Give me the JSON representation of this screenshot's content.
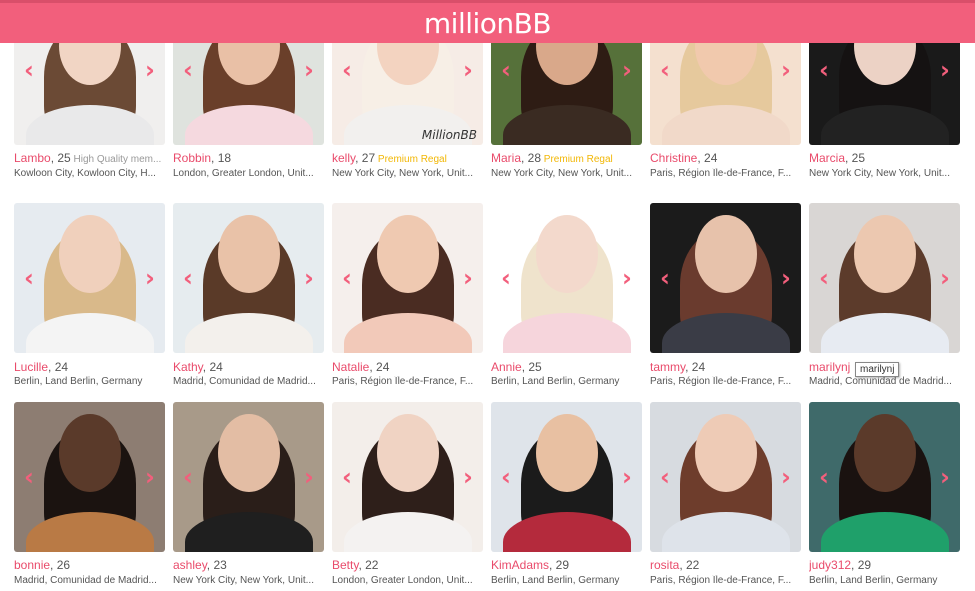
{
  "header": {
    "logo_text": "millionBB",
    "brand_color": "#f25f7c"
  },
  "tooltip": {
    "text": "marilynj"
  },
  "profiles": [
    {
      "name": "Lambo",
      "age": ", 25",
      "tag": " High Quality mem...",
      "tag_style": "grey",
      "location": "Kowloon City, Kowloon City, H...",
      "skin": "#f1d5c4",
      "hair": "#6b4a35",
      "cloth": "#e9e9ea",
      "bg": "#f0efee"
    },
    {
      "name": "Robbin",
      "age": ", 18",
      "tag": "",
      "tag_style": "",
      "location": "London, Greater London, Unit...",
      "skin": "#e9c0a6",
      "hair": "#6a3f2a",
      "cloth": "#f5d9df",
      "bg": "#dfe3de"
    },
    {
      "name": "kelly",
      "age": ", 27",
      "tag": " Premium Regal",
      "tag_style": "gold",
      "location": "New York City, New York, Unit...",
      "skin": "#f3d3c0",
      "hair": "#f7efe6",
      "cloth": "#f2f0ee",
      "bg": "#f6ece6",
      "watermark": "MillionBB"
    },
    {
      "name": "Maria",
      "age": ", 28",
      "tag": " Premium Regal",
      "tag_style": "gold",
      "location": "New York City, New York, Unit...",
      "skin": "#d9a88a",
      "hair": "#2e1c14",
      "cloth": "#3a2b22",
      "bg": "#56713a"
    },
    {
      "name": "Christine",
      "age": ", 24",
      "tag": "",
      "tag_style": "",
      "location": "Paris, Région Île-de-France, F...",
      "skin": "#f1c9ad",
      "hair": "#e6c99d",
      "cloth": "#f1d9c9",
      "bg": "#f4e0cf"
    },
    {
      "name": "Marcia",
      "age": ", 25",
      "tag": "",
      "tag_style": "",
      "location": "New York City, New York, Unit...",
      "skin": "#ecd2c5",
      "hair": "#151212",
      "cloth": "#222222",
      "bg": "#1a1a1a"
    },
    {
      "name": "Lucille",
      "age": ", 24",
      "tag": "",
      "tag_style": "",
      "location": "Berlin, Land Berlin, Germany",
      "skin": "#f0d0bc",
      "hair": "#d9b98a",
      "cloth": "#f4f4f4",
      "bg": "#e6ebf0"
    },
    {
      "name": "Kathy",
      "age": ", 24",
      "tag": "",
      "tag_style": "",
      "location": "Madrid, Comunidad de Madrid...",
      "skin": "#e9c2a8",
      "hair": "#5a3a28",
      "cloth": "#f3f0ec",
      "bg": "#e6ecef"
    },
    {
      "name": "Natalie",
      "age": ", 24",
      "tag": "",
      "tag_style": "",
      "location": "Paris, Région Île-de-France, F...",
      "skin": "#efc9b1",
      "hair": "#4a2c22",
      "cloth": "#f2c9b9",
      "bg": "#f5efec"
    },
    {
      "name": "Annie",
      "age": ", 25",
      "tag": "",
      "tag_style": "",
      "location": "Berlin, Land Berlin, Germany",
      "skin": "#f3d9cc",
      "hair": "#efe3cc",
      "cloth": "#f6d5dc",
      "bg": "#ffffff"
    },
    {
      "name": "tammy",
      "age": ", 24",
      "tag": "",
      "tag_style": "",
      "location": "Paris, Région Île-de-France, F...",
      "skin": "#e7c2ab",
      "hair": "#6a3b2e",
      "cloth": "#3a3c46",
      "bg": "#1b1b1b"
    },
    {
      "name": "marilynj",
      "age": "",
      "tag": "",
      "tag_style": "",
      "location": "Madrid, Comunidad de Madrid...",
      "skin": "#ecc8b0",
      "hair": "#5c3b2b",
      "cloth": "#e7ebf2",
      "bg": "#d9d6d4"
    },
    {
      "name": "bonnie",
      "age": ", 26",
      "tag": "",
      "tag_style": "",
      "location": "Madrid, Comunidad de Madrid...",
      "skin": "#5a3a2a",
      "hair": "#1b1310",
      "cloth": "#b97a45",
      "bg": "#8d7d72"
    },
    {
      "name": "ashley",
      "age": ", 23",
      "tag": "",
      "tag_style": "",
      "location": "New York City, New York, Unit...",
      "skin": "#e3bda4",
      "hair": "#2a1e19",
      "cloth": "#1f1f1f",
      "bg": "#a89a89"
    },
    {
      "name": "Betty",
      "age": ", 22",
      "tag": "",
      "tag_style": "",
      "location": "London, Greater London, Unit...",
      "skin": "#f0d3c3",
      "hair": "#2e1f1a",
      "cloth": "#f4f2f1",
      "bg": "#f3eeea"
    },
    {
      "name": "KimAdams",
      "age": ", 29",
      "tag": "",
      "tag_style": "",
      "location": "Berlin, Land Berlin, Germany",
      "skin": "#e8c0a2",
      "hair": "#1b1b1b",
      "cloth": "#b42a3c",
      "bg": "#dfe4ea"
    },
    {
      "name": "rosita",
      "age": ", 22",
      "tag": "",
      "tag_style": "",
      "location": "Paris, Région Île-de-France, F...",
      "skin": "#eecbb6",
      "hair": "#6e3d2c",
      "cloth": "#dee3ea",
      "bg": "#d7dbe0"
    },
    {
      "name": "judy312",
      "age": ", 29",
      "tag": "",
      "tag_style": "",
      "location": "Berlin, Land Berlin, Germany",
      "skin": "#5b3a2a",
      "hair": "#1a1210",
      "cloth": "#1fa06a",
      "bg": "#3f6a6a"
    }
  ],
  "icons": {
    "prev": "chevron-left-icon",
    "next": "chevron-right-icon"
  },
  "arrow_glyphs": {
    "prev": "‹",
    "next": "›"
  }
}
